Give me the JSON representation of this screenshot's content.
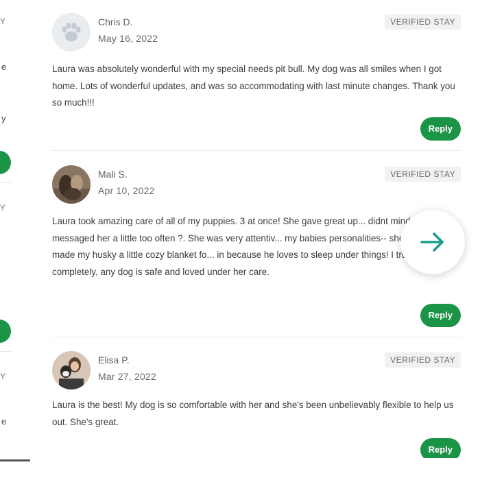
{
  "colors": {
    "accent_green": "#1b9447",
    "arrow_teal": "#1a9c8c"
  },
  "left_column": {
    "fragments": [
      {
        "text": "Y"
      },
      {
        "text": "e"
      },
      {
        "text": "y"
      },
      {
        "text": "Y"
      },
      {
        "text": "Y"
      },
      {
        "text": "e"
      }
    ]
  },
  "reviews": [
    {
      "name": "Chris D.",
      "date": "May 16, 2022",
      "badge": "VERIFIED STAY",
      "avatar_icon": "paw-icon",
      "body": "Laura was absolutely wonderful with my special needs pit bull. My dog was all smiles when I got home. Lots of wonderful updates, and was so accommodating with last minute changes. Thank you so much!!!",
      "reply_label": "Reply"
    },
    {
      "name": "Mali S.",
      "date": "Apr 10, 2022",
      "badge": "VERIFIED STAY",
      "avatar_icon": "user-photo-icon",
      "body": "Laura took amazing care of all of my puppies. 3 at once! She gave great up... didnt mind when I messaged her a little too often ?. She was very attentiv... my babies personalities-- she even made my husky a little cozy blanket fo... in because he loves to sleep under things! I trust Laura completely, any dog is safe and loved under her care.",
      "reply_label": "Reply"
    },
    {
      "name": "Elisa P.",
      "date": "Mar 27, 2022",
      "badge": "VERIFIED STAY",
      "avatar_icon": "user-photo-icon",
      "body": "Laura is the best! My dog is so comfortable with her and she's been unbelievably flexible to help us out. She's great.",
      "reply_label": "Reply"
    }
  ],
  "carousel": {
    "next_icon": "arrow-right-icon"
  }
}
